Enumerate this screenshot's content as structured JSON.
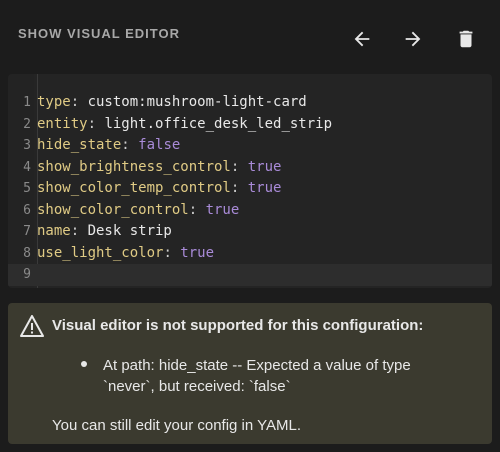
{
  "toolbar": {
    "show_visual_editor_label": "SHOW VISUAL EDITOR",
    "undo_icon": "arrow-left-icon",
    "redo_icon": "arrow-right-icon",
    "delete_icon": "trash-icon",
    "icon_color": "#e8e8e8"
  },
  "editor": {
    "lines": [
      {
        "num": "1",
        "key": "type",
        "sep": ": ",
        "value": "custom:mushroom-light-card",
        "kind": "text"
      },
      {
        "num": "2",
        "key": "entity",
        "sep": ": ",
        "value": "light.office_desk_led_strip",
        "kind": "text"
      },
      {
        "num": "3",
        "key": "hide_state",
        "sep": ": ",
        "value": "false",
        "kind": "bool"
      },
      {
        "num": "4",
        "key": "show_brightness_control",
        "sep": ": ",
        "value": "true",
        "kind": "bool"
      },
      {
        "num": "5",
        "key": "show_color_temp_control",
        "sep": ": ",
        "value": "true",
        "kind": "bool"
      },
      {
        "num": "6",
        "key": "show_color_control",
        "sep": ": ",
        "value": "true",
        "kind": "bool"
      },
      {
        "num": "7",
        "key": "name",
        "sep": ": ",
        "value": "Desk strip",
        "kind": "text"
      },
      {
        "num": "8",
        "key": "use_light_color",
        "sep": ": ",
        "value": "true",
        "kind": "bool"
      },
      {
        "num": "9",
        "key": "",
        "sep": "",
        "value": "",
        "kind": "text"
      }
    ],
    "colors": {
      "key": "#e0cb85",
      "bool": "#a98bd8",
      "text": "#e8e8e8"
    }
  },
  "warning": {
    "icon": "alert-triangle-icon",
    "title": "Visual editor is not supported for this configuration:",
    "items": [
      "At path: hide_state -- Expected a value of type `never`, but received: `false`"
    ],
    "footer": "You can still edit your config in YAML.",
    "background": "#3b3a2f"
  }
}
